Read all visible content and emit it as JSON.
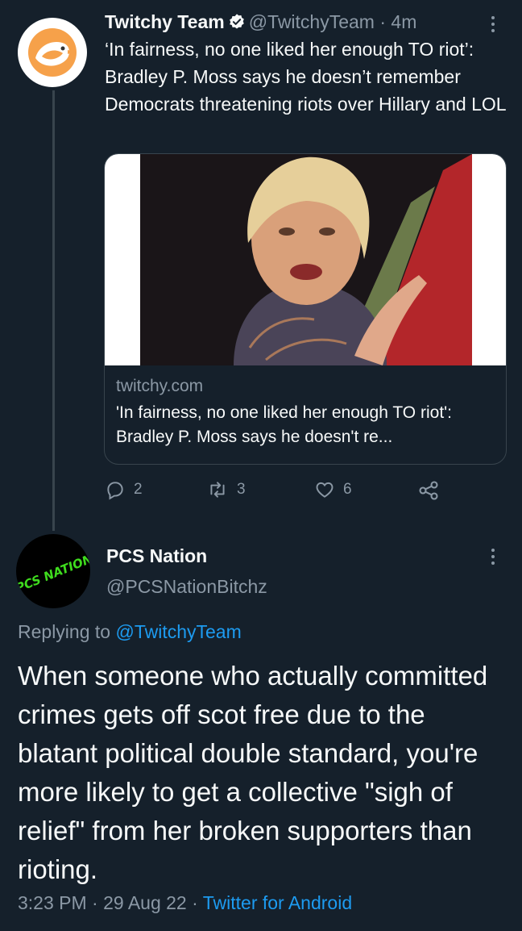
{
  "tweet1": {
    "name": "Twitchy Team",
    "handle": "@TwitchyTeam",
    "time": "4m",
    "text": "‘In fairness, no one liked her enough TO riot’: Bradley P. Moss says he doesn’t remember Democrats threatening riots over Hillary and LOL",
    "card": {
      "domain": "twitchy.com",
      "title": "'In fairness, no one liked her enough TO riot': Bradley P. Moss says he doesn't re..."
    },
    "actions": {
      "replies": "2",
      "retweets": "3",
      "likes": "6"
    }
  },
  "tweet2": {
    "avatar_text": "PCS NATION",
    "name": "PCS Nation",
    "handle": "@PCSNationBitchz",
    "replying_prefix": "Replying to ",
    "replying_to": "@TwitchyTeam",
    "text": "When someone who actually committed crimes gets off scot free due to the blatant political double standard, you're more likely to get a collective \"sigh of relief\" from her broken supporters than rioting.",
    "time": "3:23 PM",
    "date": "29 Aug 22",
    "source": "Twitter for Android"
  },
  "colors": {
    "background": "#15202b",
    "text": "#f7f9f9",
    "muted": "#8b98a5",
    "link": "#1d9bf0",
    "divider": "#38444d"
  }
}
